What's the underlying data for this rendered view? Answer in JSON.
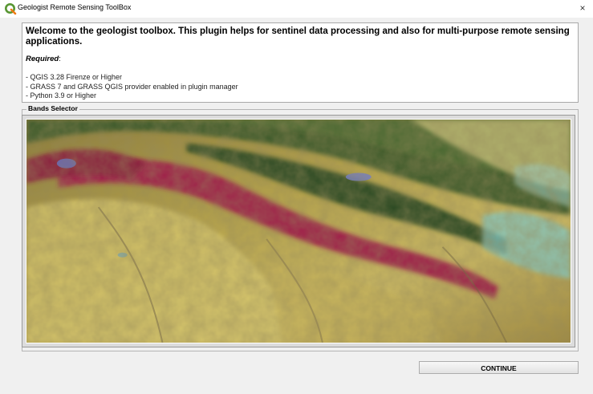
{
  "window": {
    "title": "Geologist Remote Sensing ToolBox",
    "close_glyph": "×",
    "icon": "qgis-icon"
  },
  "info": {
    "welcome": "Welcome to the geologist toolbox. This plugin helps for sentinel data processing and also for multi-purpose remote sensing applications.",
    "required_label": "Required",
    "requirements": [
      "- QGIS 3.28 Firenze or Higher",
      "- GRASS 7 and GRASS QGIS provider enabled in plugin manager",
      "- Python 3.9 or Higher"
    ]
  },
  "bands_selector": {
    "label": "Bands Selector"
  },
  "actions": {
    "continue_label": "CONTINUE"
  },
  "colors": {
    "background": "#f0f0f0",
    "qgis_green": "#589632",
    "qgis_yellow": "#ee7913"
  }
}
